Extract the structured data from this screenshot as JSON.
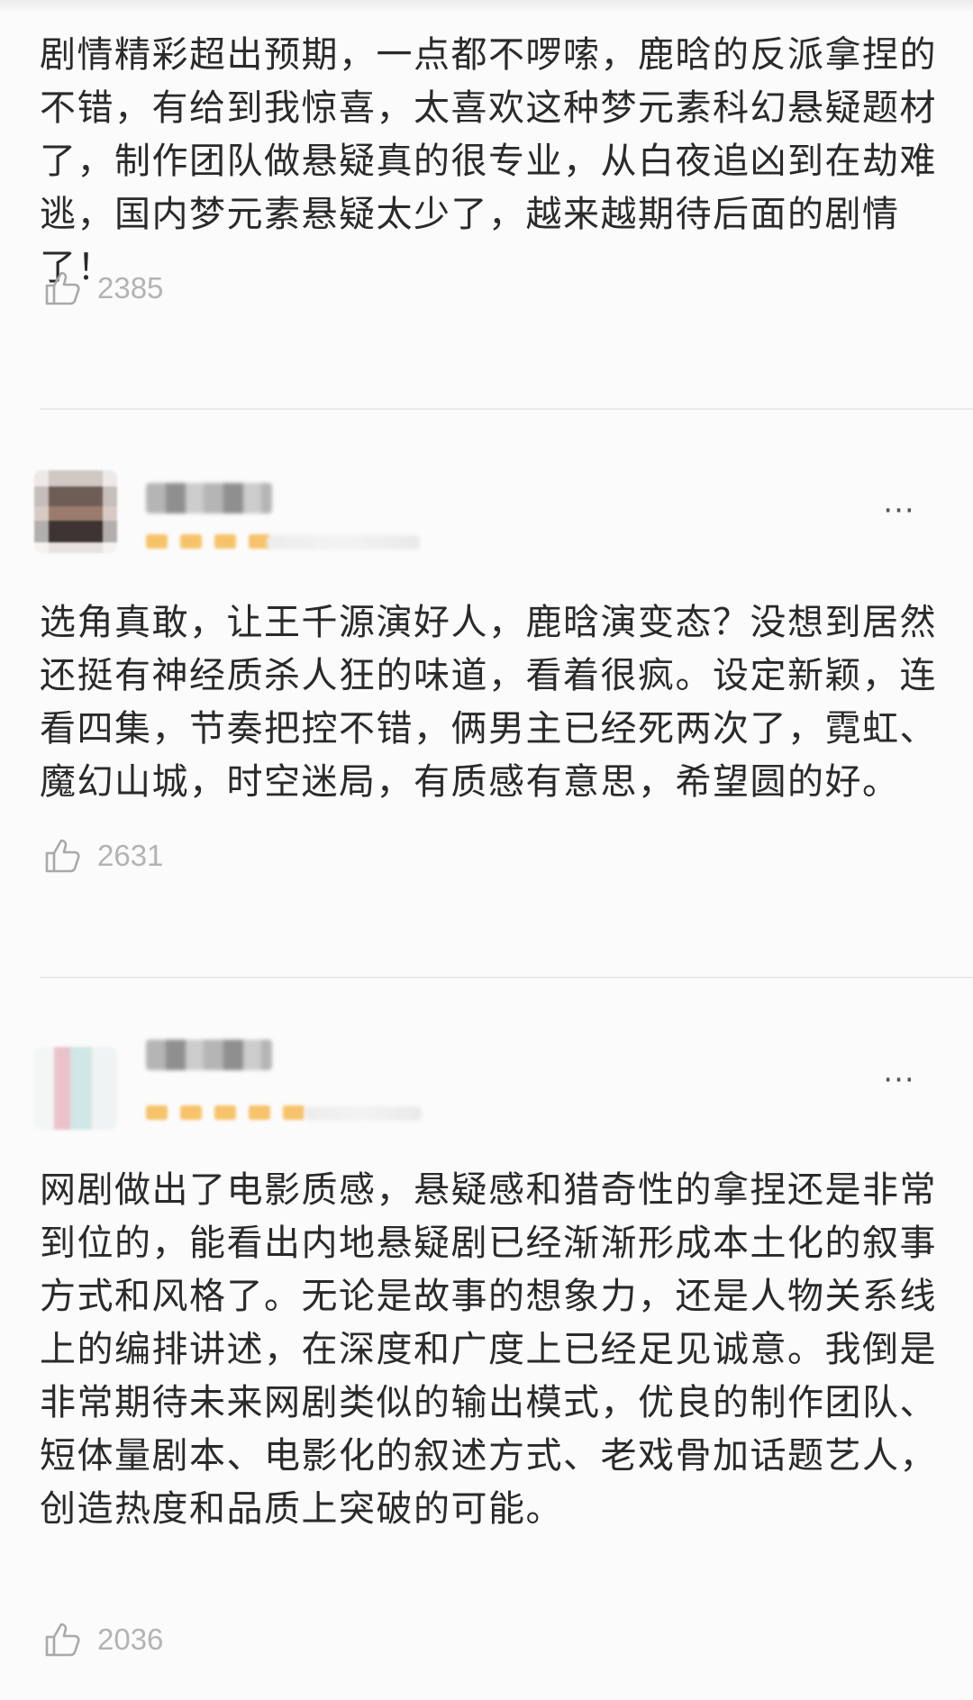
{
  "comments": [
    {
      "text": "剧情精彩超出预期，一点都不啰嗦，鹿晗的反派拿捏的不错，有给到我惊喜，太喜欢这种梦元素科幻悬疑题材了，制作团队做悬疑真的很专业，从白夜追凶到在劫难逃，国内梦元素悬疑太少了，越来越期待后面的剧情了！",
      "likes": "2385"
    },
    {
      "text": "选角真敢，让王千源演好人，鹿晗演变态？没想到居然还挺有神经质杀人狂的味道，看着很疯。设定新颖，连看四集，节奏把控不错，俩男主已经死两次了，霓虹、魔幻山城，时空迷局，有质感有意思，希望圆的好。",
      "likes": "2631",
      "more": "···"
    },
    {
      "text": "网剧做出了电影质感，悬疑感和猎奇性的拿捏还是非常到位的，能看出内地悬疑剧已经渐渐形成本土化的叙事方式和风格了。无论是故事的想象力，还是人物关系线上的编排讲述，在深度和广度上已经足见诚意。我倒是非常期待未来网剧类似的输出模式，优良的制作团队、短体量剧本、电影化的叙述方式、老戏骨加话题艺人，创造热度和品质上突破的可能。",
      "likes": "2036",
      "more": "···"
    }
  ],
  "colors": {
    "background": "#fbfbfb",
    "text": "#2a2a2a",
    "like_count": "#b3b3b3",
    "divider": "#e9e9e9",
    "rating_star": "#f7c36a"
  },
  "icons": {
    "like": "thumbs-up-outline-icon",
    "more": "more-dots-icon"
  }
}
